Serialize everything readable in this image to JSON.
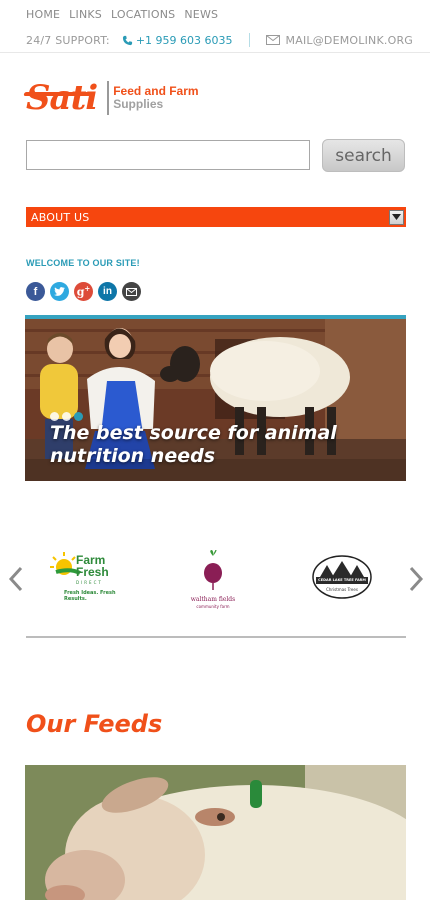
{
  "top_nav": [
    "HOME",
    "LINKS",
    "LOCATIONS",
    "NEWS"
  ],
  "support": {
    "label": "24/7 SUPPORT:",
    "phone": "+1 959 603 6035",
    "email": "MAIL@DEMOLINK.ORG"
  },
  "logo": {
    "brand": "Sati",
    "tagline_line1": "Feed and Farm",
    "tagline_line2": "Supplies"
  },
  "search": {
    "value": "",
    "button_label": "search"
  },
  "menu": {
    "selected": "ABOUT US"
  },
  "welcome": {
    "title": "WELCOME TO OUR SITE!",
    "social_icons": [
      "facebook-icon",
      "twitter-icon",
      "google-plus-icon",
      "linkedin-icon",
      "email-icon"
    ]
  },
  "hero": {
    "caption_line1": "The best source for animal",
    "caption_line2": "nutrition needs",
    "slides": 3,
    "active_slide": 3
  },
  "partners": {
    "items": [
      {
        "name_line1": "Farm",
        "name_line2": "Fresh",
        "sub": "DIRECT",
        "tagline": "Fresh Ideas. Fresh Results."
      },
      {
        "name_line1": "waltham fields",
        "sub": "community farm"
      },
      {
        "name_line1": "CEDAR LAKE TREE FARM",
        "sub": "Christmas Trees"
      }
    ]
  },
  "feeds": {
    "title": "Our Feeds"
  },
  "colors": {
    "accent": "#f0501a",
    "teal": "#2a9bb6",
    "menu_bg": "#f6460e"
  }
}
